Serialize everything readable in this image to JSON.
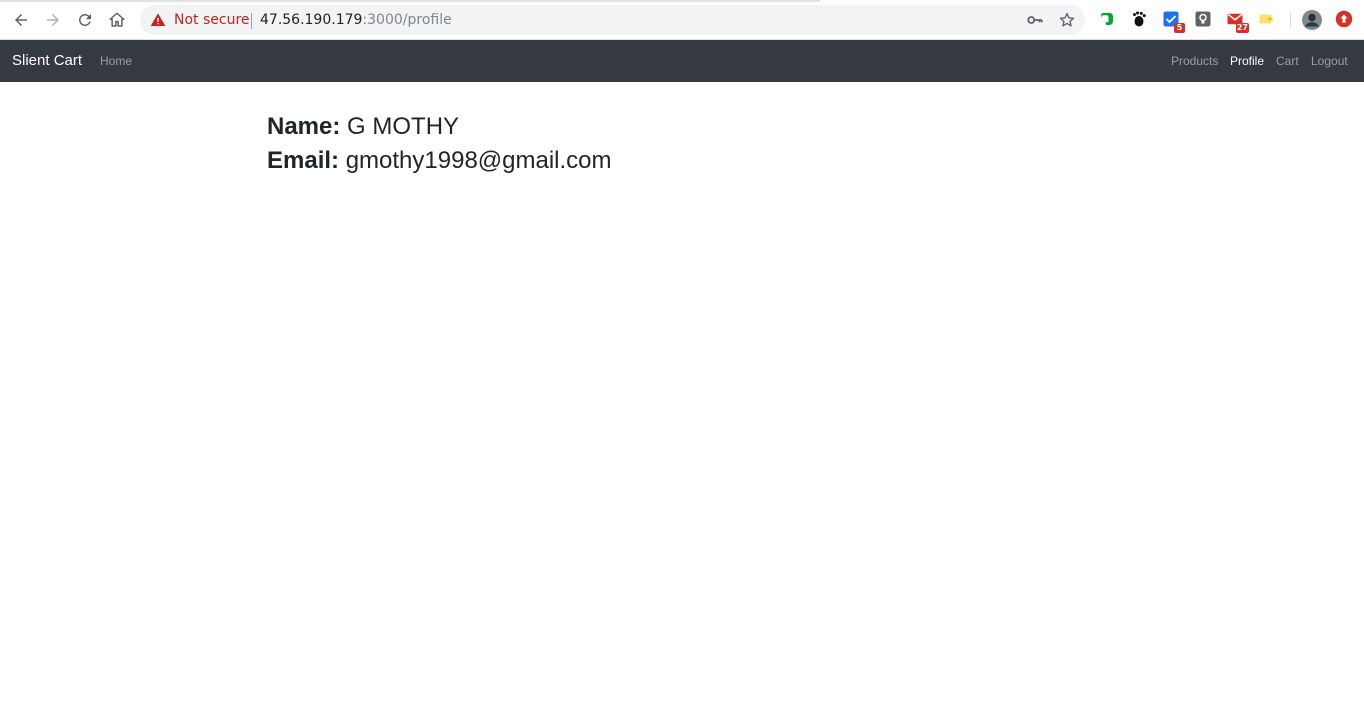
{
  "browser": {
    "security_text": "Not secure",
    "url_host": "47.56.190.179",
    "url_rest": ":3000/profile",
    "icons": [
      "back-arrow-icon",
      "forward-arrow-icon",
      "reload-icon",
      "home-icon",
      "warning-triangle-icon",
      "key-icon",
      "star-icon"
    ],
    "extensions": [
      {
        "name": "evernote-icon",
        "badge": ""
      },
      {
        "name": "gnome-foot-icon",
        "badge": ""
      },
      {
        "name": "task-check-icon",
        "badge": "5"
      },
      {
        "name": "keep-bulb-icon",
        "badge": ""
      },
      {
        "name": "gmail-icon",
        "badge": "27"
      },
      {
        "name": "highlighter-icon",
        "badge": ""
      },
      {
        "name": "avatar",
        "badge": ""
      },
      {
        "name": "upload-arrow-icon",
        "badge": ""
      }
    ],
    "colors": {
      "warning": "#c5221f",
      "omnibox_bg": "#f1f3f4"
    }
  },
  "navbar": {
    "brand": "Slient Cart",
    "left_links": [
      {
        "label": "Home"
      }
    ],
    "right_links": [
      {
        "label": "Products",
        "active": false
      },
      {
        "label": "Profile",
        "active": true
      },
      {
        "label": "Cart",
        "active": false
      },
      {
        "label": "Logout",
        "active": false
      }
    ],
    "colors": {
      "background": "#343a40",
      "active_link": "#ffffff"
    }
  },
  "profile": {
    "name_label": "Name:",
    "name_value": "G MOTHY",
    "email_label": "Email:",
    "email_value": "gmothy1998@gmail.com"
  }
}
